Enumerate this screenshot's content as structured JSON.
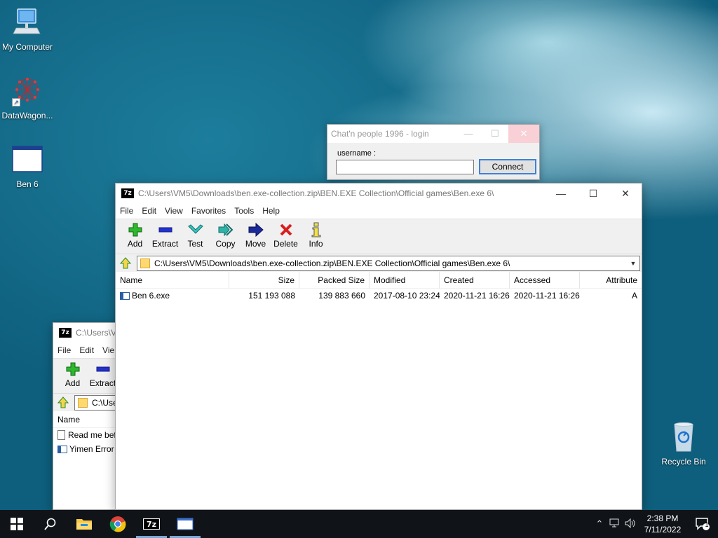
{
  "desktop": {
    "icons": [
      {
        "label": "My Computer",
        "icon": "monitor-icon"
      },
      {
        "label": "DataWagon...",
        "icon": "molecule-icon"
      },
      {
        "label": "Ben 6",
        "icon": "window-icon"
      },
      {
        "label": "Recycle Bin",
        "icon": "recycle-bin-icon"
      }
    ]
  },
  "chat_login": {
    "title": "Chat'n people 1996 - login",
    "username_label": "username :",
    "username_value": "",
    "connect_label": "Connect"
  },
  "zip_main": {
    "title": "C:\\Users\\VM5\\Downloads\\ben.exe-collection.zip\\BEN.EXE Collection\\Official games\\Ben.exe 6\\",
    "menu": [
      "File",
      "Edit",
      "View",
      "Favorites",
      "Tools",
      "Help"
    ],
    "toolbar": [
      {
        "label": "Add",
        "icon": "plus-icon"
      },
      {
        "label": "Extract",
        "icon": "minus-icon"
      },
      {
        "label": "Test",
        "icon": "check-icon"
      },
      {
        "label": "Copy",
        "icon": "double-arrow-icon"
      },
      {
        "label": "Move",
        "icon": "arrow-right-icon"
      },
      {
        "label": "Delete",
        "icon": "x-icon"
      },
      {
        "label": "Info",
        "icon": "info-icon"
      }
    ],
    "address": "C:\\Users\\VM5\\Downloads\\ben.exe-collection.zip\\BEN.EXE Collection\\Official games\\Ben.exe 6\\",
    "columns": [
      "Name",
      "Size",
      "Packed Size",
      "Modified",
      "Created",
      "Accessed",
      "Attribute"
    ],
    "rows": [
      {
        "name": "Ben 6.exe",
        "size": "151 193 088",
        "packed": "139 883 660",
        "modified": "2017-08-10 23:24",
        "created": "2020-11-21 16:26",
        "accessed": "2020-11-21 16:26",
        "attr": "A"
      }
    ]
  },
  "zip_back": {
    "title": "C:\\Users\\VM",
    "menu": [
      "File",
      "Edit",
      "Vie"
    ],
    "toolbar": [
      {
        "label": "Add",
        "icon": "plus-icon"
      },
      {
        "label": "Extract",
        "icon": "minus-icon"
      }
    ],
    "address": "C:\\Use",
    "column": "Name",
    "rows": [
      "Read me bef",
      "Yimen Error"
    ]
  },
  "taskbar": {
    "time": "2:38 PM",
    "date": "7/11/2022",
    "notification_count": "1",
    "apps": [
      "file-explorer-icon",
      "chrome-icon",
      "7zip-icon",
      "ben6-icon"
    ]
  }
}
